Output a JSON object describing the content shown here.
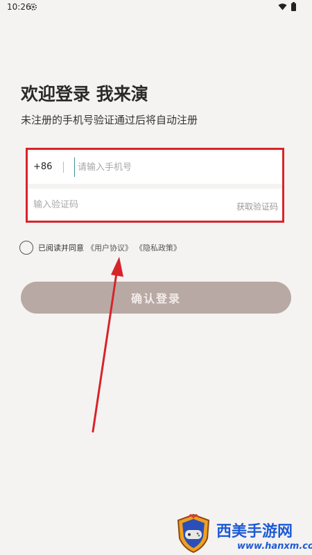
{
  "status_bar": {
    "time": "10:26",
    "icons": [
      "gear-icon",
      "wifi-icon",
      "battery-icon"
    ]
  },
  "header": {
    "title": "欢迎登录 我来演",
    "subtitle": "未注册的手机号验证通过后将自动注册"
  },
  "form": {
    "country_code": "+86",
    "phone_placeholder": "请输入手机号",
    "phone_value": "",
    "code_placeholder": "输入验证码",
    "code_value": "",
    "get_code_label": "获取验证码"
  },
  "agreement": {
    "prefix": "已阅读并同意",
    "user_agreement": "《用户协议》",
    "privacy_policy": "《隐私政策》",
    "checked": false
  },
  "actions": {
    "login_label": "确认登录"
  },
  "watermark": {
    "title": "西美手游网",
    "url": "www.hanxm.com"
  },
  "colors": {
    "background": "#f4f3f1",
    "login_button": "#b8a9a4",
    "annotation_red": "#d8232a",
    "watermark_blue": "#1e5ad6"
  }
}
